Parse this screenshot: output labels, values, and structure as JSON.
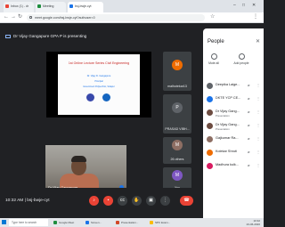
{
  "browser": {
    "tabs": [
      {
        "label": "Inbox (1) - dr",
        "color": "#ea4335",
        "active": false
      },
      {
        "label": "Meeting",
        "color": "#1e8e3e",
        "active": false
      },
      {
        "label": "bsj-bwje-cyt",
        "color": "#1a73e8",
        "active": true
      }
    ],
    "url": "meet.google.com/bsj-bwje-cyt?authuser=0"
  },
  "meet": {
    "presenting_banner": "Dr Vijay Gangapure GPA P is presenting",
    "slide": {
      "title": "1st Online Lecture Series Civil Engineering",
      "line1": "Dr. Vijay D. Gangapure",
      "line2": "Principal",
      "line3": "Government Polytechnic, Solapur"
    },
    "camera_name": "Dr Vijay Gangapure",
    "tiles": [
      {
        "label": "malhotekar13",
        "initial": "M",
        "color": "#ef6c00"
      },
      {
        "label": "PRASAD VIBH...",
        "initial": "P",
        "color": "#5f6368"
      },
      {
        "label": "26 others",
        "initial": "M",
        "color": "#8d6e63"
      },
      {
        "label": "You",
        "initial": "M",
        "color": "#7e57c2"
      }
    ],
    "time": "10:32 AM",
    "meeting_code": "bsj-bwje-cyt"
  },
  "people": {
    "title": "People",
    "mute_all": "Mute all",
    "add_people": "Add people",
    "participants": [
      {
        "name": "Deepika Laige...",
        "sub": "",
        "color": "#5f6368",
        "muted": "yes"
      },
      {
        "name": "DKTE YCP CE...",
        "sub": "",
        "color": "#1a73e8",
        "muted": "yes"
      },
      {
        "name": "Dr Vijay Gang...",
        "sub": "Presentation",
        "color": "#6d4c41",
        "muted": "yes"
      },
      {
        "name": "Dr Vijay Gang...",
        "sub": "Presentation",
        "color": "#6d4c41",
        "muted": "yes"
      },
      {
        "name": "Gajkumar Ra...",
        "sub": "",
        "color": "#8d6e63",
        "muted": "yes"
      },
      {
        "name": "Kolekar Shruti",
        "sub": "",
        "color": "#ef6c00",
        "muted": "yes"
      },
      {
        "name": "Madhura kulk...",
        "sub": "",
        "color": "#d81b60",
        "muted": "yes"
      }
    ]
  },
  "taskbar": {
    "search_placeholder": "Type here to search",
    "apps": [
      {
        "label": "Google Meet",
        "color": "#1e8e3e"
      },
      {
        "label": "Screen...",
        "color": "#1a73e8"
      },
      {
        "label": "Presentation...",
        "color": "#d24726"
      },
      {
        "label": "SPC Exam...",
        "color": "#fbbc04"
      }
    ],
    "clock_time": "10:32",
    "clock_date": "23-06-2020"
  },
  "icons": {
    "mic": "microphone-icon",
    "camera": "video-camera-icon",
    "captions": "captions-icon",
    "present": "present-screen-icon",
    "hangup": "hangup-icon"
  }
}
